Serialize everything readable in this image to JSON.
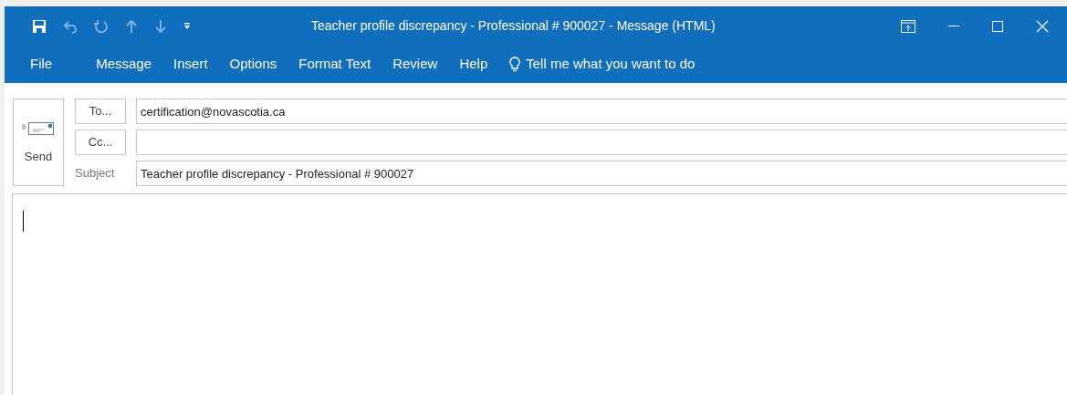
{
  "window": {
    "title": "Teacher profile discrepancy - Professional # 900027  -  Message (HTML)"
  },
  "quick_access": [
    {
      "kind": "save",
      "disabled": false
    },
    {
      "kind": "undo",
      "disabled": true
    },
    {
      "kind": "redo",
      "disabled": true
    },
    {
      "kind": "up",
      "disabled": true
    },
    {
      "kind": "down",
      "disabled": true
    },
    {
      "kind": "customize",
      "disabled": false
    }
  ],
  "ribbon_tabs": [
    {
      "label": "File",
      "selected": false
    },
    {
      "label": "Message",
      "selected": false
    },
    {
      "label": "Insert",
      "selected": false
    },
    {
      "label": "Options",
      "selected": false
    },
    {
      "label": "Format Text",
      "selected": false
    },
    {
      "label": "Review",
      "selected": false
    },
    {
      "label": "Help",
      "selected": false
    }
  ],
  "tell_me": {
    "placeholder": "Tell me what you want to do"
  },
  "send_button": {
    "label": "Send"
  },
  "to_button": {
    "label": "To..."
  },
  "to_field": {
    "value": "certification@novascotia.ca"
  },
  "cc_button": {
    "label": "Cc..."
  },
  "subject": {
    "label": "Subject",
    "value": "Teacher profile discrepancy - Professional # 900027"
  }
}
